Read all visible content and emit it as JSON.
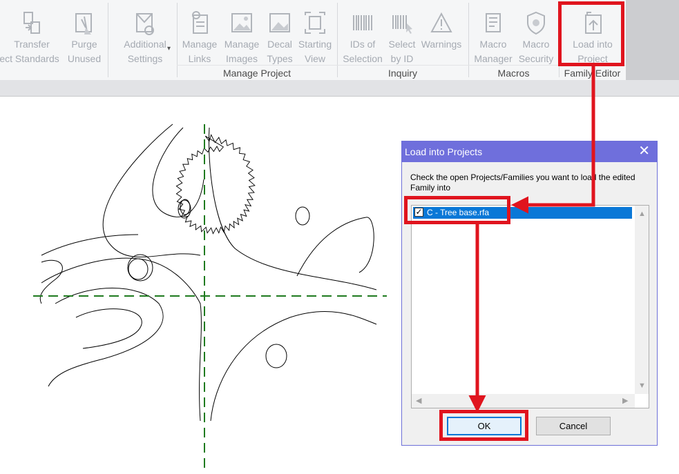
{
  "ribbon": {
    "buttons": [
      {
        "id": "transfer",
        "line1": "Transfer",
        "line2": "ject Standards",
        "icon": "transfer-project-standards-icon"
      },
      {
        "id": "purge",
        "line1": "Purge",
        "line2": "Unused",
        "icon": "purge-unused-icon"
      },
      {
        "id": "additional",
        "line1": "Additional",
        "line2": "Settings",
        "icon": "additional-settings-icon"
      },
      {
        "id": "manage-links",
        "line1": "Manage",
        "line2": "Links",
        "icon": "manage-links-icon"
      },
      {
        "id": "manage-images",
        "line1": "Manage",
        "line2": "Images",
        "icon": "manage-images-icon"
      },
      {
        "id": "decal-types",
        "line1": "Decal",
        "line2": "Types",
        "icon": "decal-types-icon"
      },
      {
        "id": "starting-view",
        "line1": "Starting",
        "line2": "View",
        "icon": "starting-view-icon"
      },
      {
        "id": "ids-of-selection",
        "line1": "IDs of",
        "line2": "Selection",
        "icon": "ids-of-selection-icon"
      },
      {
        "id": "select-by-id",
        "line1": "Select",
        "line2": "by ID",
        "icon": "select-by-id-icon"
      },
      {
        "id": "warnings",
        "line1": "Warnings",
        "line2": "",
        "icon": "warnings-icon"
      },
      {
        "id": "macro-manager",
        "line1": "Macro",
        "line2": "Manager",
        "icon": "macro-manager-icon"
      },
      {
        "id": "macro-security",
        "line1": "Macro",
        "line2": "Security",
        "icon": "macro-security-icon"
      },
      {
        "id": "load-into-project",
        "line1": "Load into",
        "line2": "Project",
        "icon": "load-into-project-icon"
      }
    ],
    "dropdown_glyph": "▾",
    "groups": {
      "manage_project": "Manage Project",
      "inquiry": "Inquiry",
      "macros": "Macros",
      "family_editor": "Family Editor"
    }
  },
  "dialog": {
    "title": "Load into Projects",
    "close_glyph": "✕",
    "instructions": "Check the open Projects/Families you want to load the edited Family into",
    "items": [
      {
        "label": "C - Tree base.rfa",
        "checked": true,
        "check_glyph": "✓"
      }
    ],
    "scroll_up": "▲",
    "scroll_down": "▼",
    "scroll_left": "◀",
    "scroll_right": "▶",
    "ok_label": "OK",
    "cancel_label": "Cancel"
  },
  "colors": {
    "highlight": "#e0141e",
    "dialog_title": "#6f6fdc",
    "selection": "#0a78d7",
    "reference_plane": "#1e7a1e"
  }
}
